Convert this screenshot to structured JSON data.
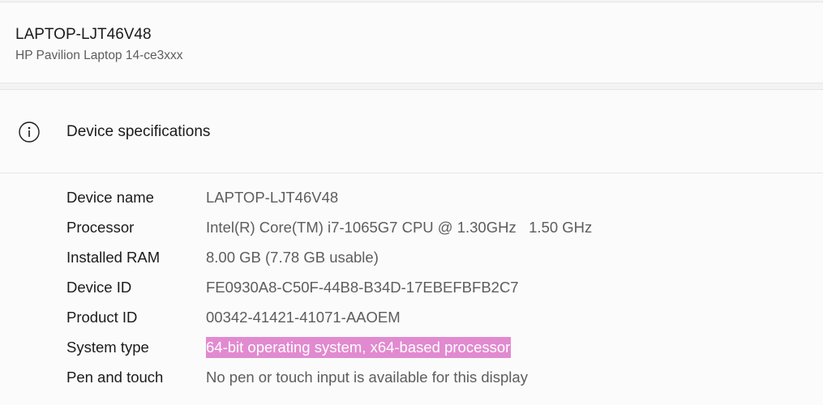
{
  "device": {
    "name": "LAPTOP-LJT46V48",
    "model": "HP Pavilion Laptop 14-ce3xxx"
  },
  "specs": {
    "title": "Device specifications",
    "icon": "info-icon",
    "rows": [
      {
        "label": "Device name",
        "value": "LAPTOP-LJT46V48"
      },
      {
        "label": "Processor",
        "value": "Intel(R) Core(TM) i7-1065G7 CPU @ 1.30GHz   1.50 GHz"
      },
      {
        "label": "Installed RAM",
        "value": "8.00 GB (7.78 GB usable)"
      },
      {
        "label": "Device ID",
        "value": "FE0930A8-C50F-44B8-B34D-17EBEFBFB2C7"
      },
      {
        "label": "Product ID",
        "value": "00342-41421-41071-AAOEM"
      },
      {
        "label": "System type",
        "value": "64-bit operating system, x64-based processor"
      },
      {
        "label": "Pen and touch",
        "value": "No pen or touch input is available for this display"
      }
    ]
  },
  "colors": {
    "selection_highlight": "#e18ad0",
    "card_background": "#fbfbfb",
    "page_background": "#f3f3f3"
  }
}
